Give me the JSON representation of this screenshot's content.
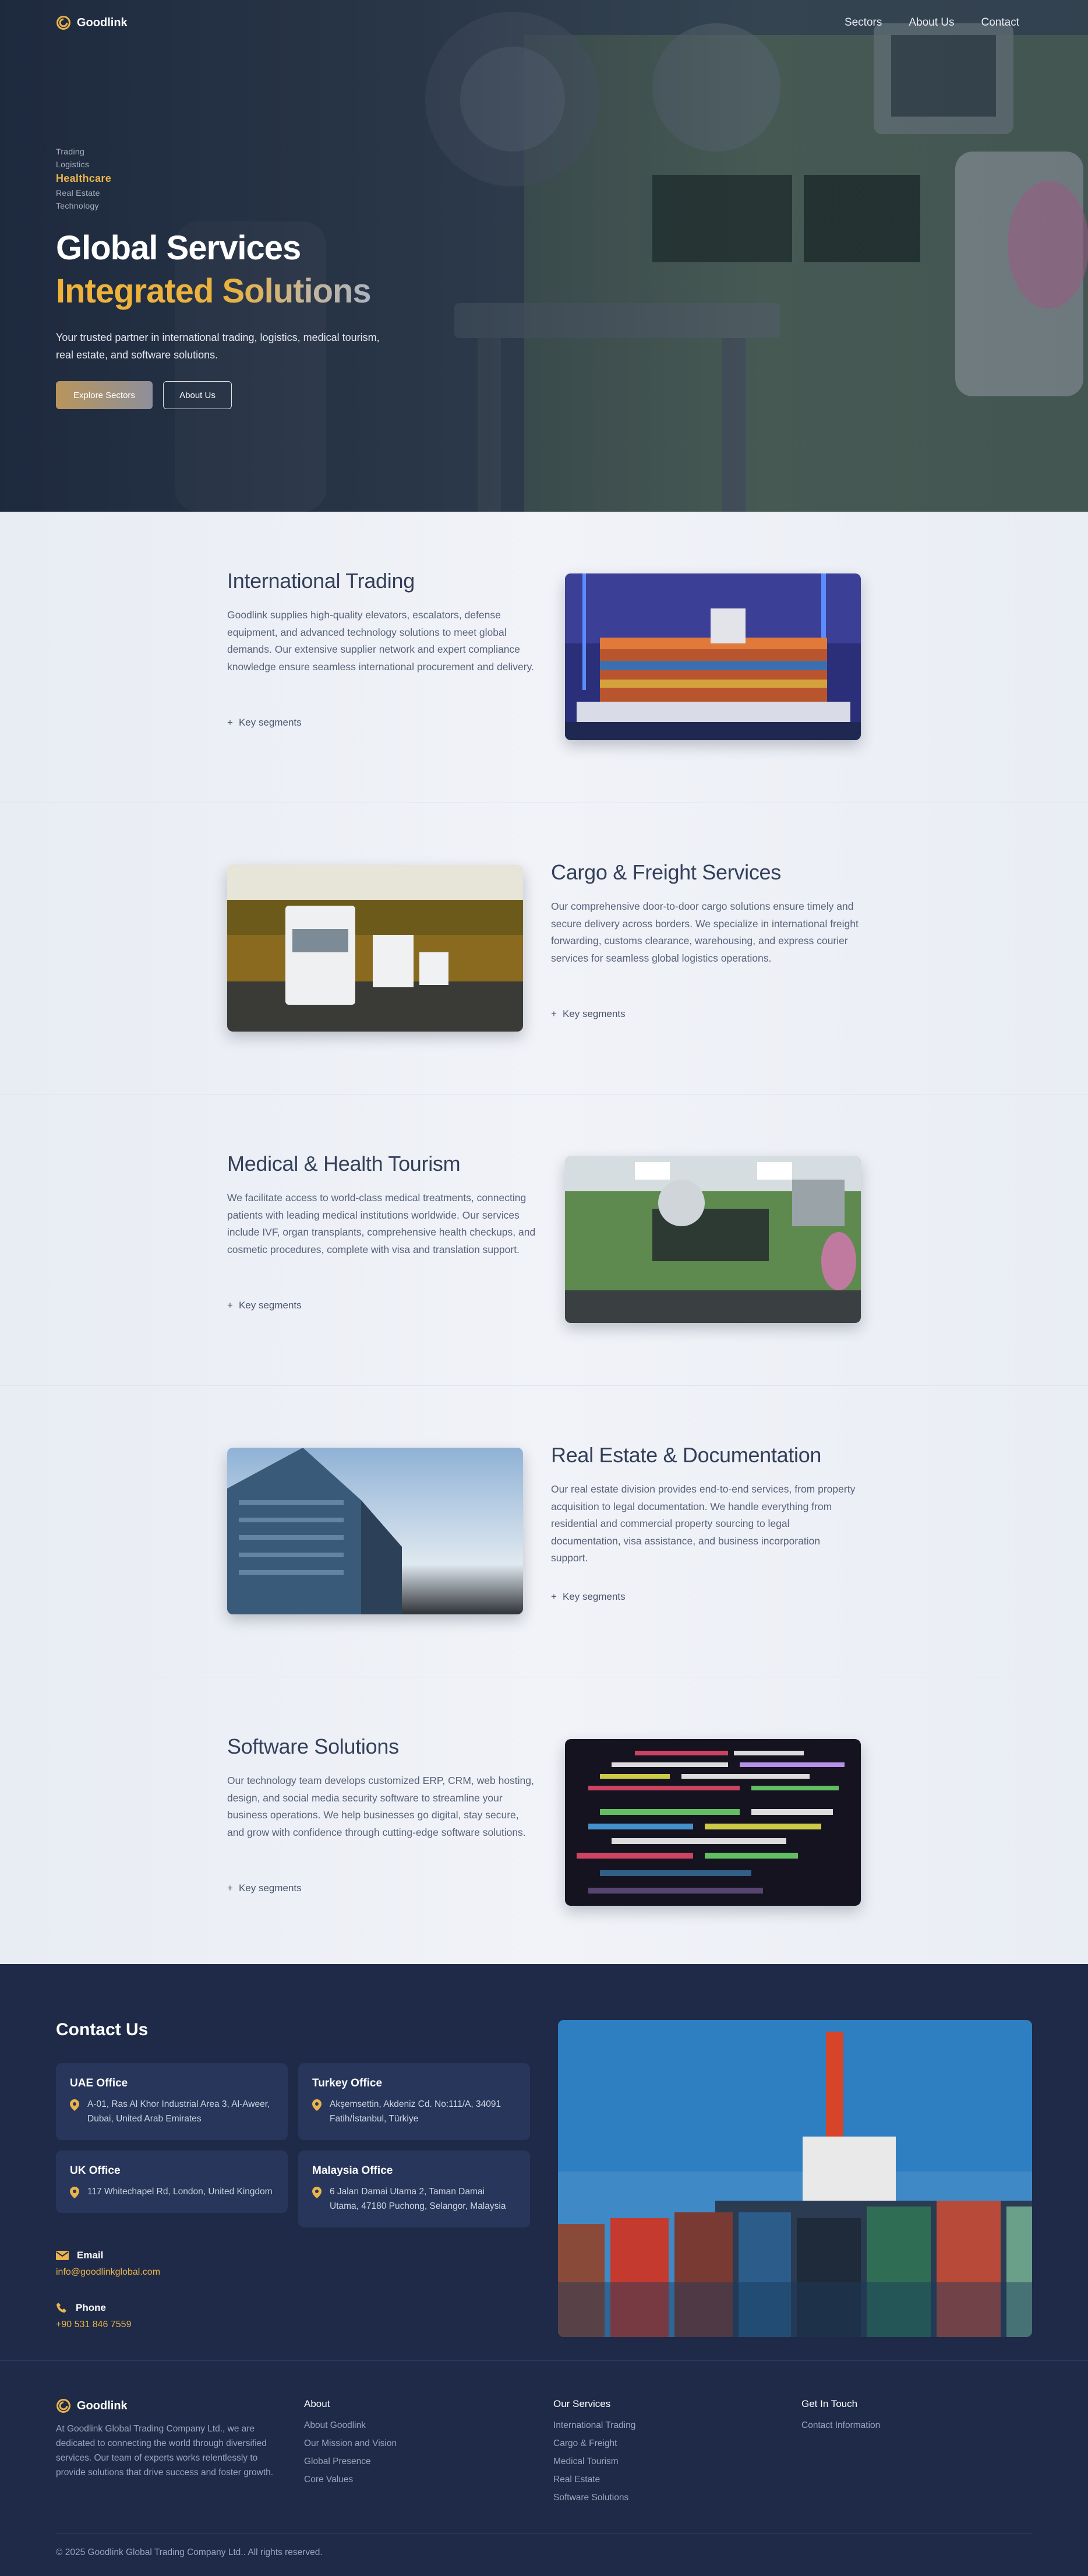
{
  "brand": {
    "name": "Goodlink",
    "logo_icon": "goodlink-logo-icon"
  },
  "nav": {
    "links": [
      "Sectors",
      "About Us",
      "Contact"
    ]
  },
  "hero": {
    "sectors": [
      "Trading",
      "Logistics",
      "Healthcare",
      "Real Estate",
      "Technology"
    ],
    "active_sector": "Healthcare",
    "title": "Global Services",
    "subtitle": "Integrated Solutions",
    "description": "Your trusted partner in international trading, logistics, medical tourism, real estate, and software solutions.",
    "primary_button": "Explore Sectors",
    "secondary_button": "About Us"
  },
  "sections": [
    {
      "title": "International Trading",
      "description": "Goodlink supplies high-quality elevators, escalators, defense equipment, and advanced technology solutions to meet global demands. Our extensive supplier network and expert compliance knowledge ensure seamless international procurement and delivery.",
      "segments_label": "Key segments",
      "image_icon": "container-ship-image"
    },
    {
      "title": "Cargo & Freight Services",
      "description": "Our comprehensive door-to-door cargo solutions ensure timely and secure delivery across borders. We specialize in international freight forwarding, customs clearance, warehousing, and express courier services for seamless global logistics operations.",
      "segments_label": "Key segments",
      "image_icon": "trucks-on-road-image"
    },
    {
      "title": "Medical & Health Tourism",
      "description": "We facilitate access to world-class medical treatments, connecting patients with leading medical institutions worldwide. Our services include IVF, organ transplants, comprehensive health checkups, and cosmetic procedures, complete with visa and translation support.",
      "segments_label": "Key segments",
      "image_icon": "operating-room-image"
    },
    {
      "title": "Real Estate & Documentation",
      "description": "Our real estate division provides end-to-end services, from property acquisition to legal documentation. We handle everything from residential and commercial property sourcing to legal documentation, visa assistance, and business incorporation support.",
      "segments_label": "Key segments",
      "image_icon": "office-building-image"
    },
    {
      "title": "Software Solutions",
      "description": "Our technology team develops customized ERP, CRM, web hosting, design, and social media security software to streamline your business operations. We help businesses go digital, stay secure, and grow with confidence through cutting-edge software solutions.",
      "segments_label": "Key segments",
      "image_icon": "source-code-image"
    }
  ],
  "contact": {
    "title": "Contact Us",
    "offices": [
      {
        "name": "UAE Office",
        "address": "A-01, Ras Al Khor Industrial Area 3, Al-Aweer, Dubai, United Arab Emirates"
      },
      {
        "name": "Turkey Office",
        "address": "Akşemsettin, Akdeniz Cd. No:111/A, 34091 Fatih/İstanbul, Türkiye"
      },
      {
        "name": "UK Office",
        "address": "117 Whitechapel Rd, London, United Kingdom"
      },
      {
        "name": "Malaysia Office",
        "address": "6 Jalan Damai Utama 2, Taman Damai Utama, 47180 Puchong, Selangor, Malaysia"
      }
    ],
    "email_label": "Email",
    "email": "info@goodlinkglobal.com",
    "phone_label": "Phone",
    "phone": "+90 531 846 7559",
    "image_icon": "cargo-containers-image"
  },
  "footer": {
    "brand": "Goodlink",
    "about_text": "At Goodlink Global Trading Company Ltd., we are dedicated to connecting the world through diversified services. Our team of experts works relentlessly to provide solutions that drive success and foster growth.",
    "about_title": "About",
    "about_links": [
      "About Goodlink",
      "Our Mission and Vision",
      "Global Presence",
      "Core Values"
    ],
    "services_title": "Our Services",
    "services_links": [
      "International Trading",
      "Cargo & Freight",
      "Medical Tourism",
      "Real Estate",
      "Software Solutions"
    ],
    "touch_title": "Get In Touch",
    "touch_links": [
      "Contact Information"
    ],
    "copyright": "© 2025 Goodlink Global Trading Company Ltd.. All rights reserved."
  },
  "colors": {
    "navy": "#1e2a47",
    "accent": "#e9b44c",
    "card": "#27365a",
    "light_bg": "#eef1f6"
  }
}
